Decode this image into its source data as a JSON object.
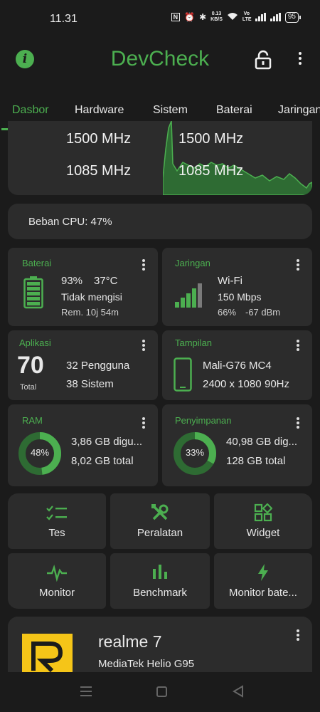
{
  "status_bar": {
    "time": "11.31",
    "nfc": "N",
    "speed_value": "0.13",
    "speed_unit": "KB/S",
    "volte": "Vo LTE",
    "battery": "95"
  },
  "app_bar": {
    "title": "DevCheck",
    "info_icon": "i"
  },
  "tabs": [
    "Dasbor",
    "Hardware",
    "Sistem",
    "Baterai",
    "Jaringan"
  ],
  "cpu_freq": {
    "rows": [
      {
        "left": "1500 MHz",
        "right": "1500 MHz"
      },
      {
        "left": "1085 MHz",
        "right": "1085 MHz"
      }
    ]
  },
  "cpu_load": {
    "label": "Beban CPU: 47%",
    "value_percent": 47
  },
  "battery_card": {
    "title": "Baterai",
    "level": "93%",
    "temp": "37°C",
    "status": "Tidak mengisi",
    "remaining": "Rem. 10j 54m"
  },
  "network_card": {
    "title": "Jaringan",
    "type": "Wi-Fi",
    "speed": "150 Mbps",
    "signal_percent": "66%",
    "signal_dbm": "-67 dBm"
  },
  "apps_card": {
    "title": "Aplikasi",
    "total": "70",
    "total_label": "Total",
    "user": "32 Pengguna",
    "system": "38 Sistem"
  },
  "display_card": {
    "title": "Tampilan",
    "gpu": "Mali-G76 MC4",
    "resolution": "2400 x 1080",
    "refresh": "90Hz"
  },
  "ram_card": {
    "title": "RAM",
    "percent": "48%",
    "percent_value": 48,
    "used": "3,86 GB digu...",
    "total": "8,02 GB total"
  },
  "storage_card": {
    "title": "Penyimpanan",
    "percent": "33%",
    "percent_value": 33,
    "used": "40,98 GB dig...",
    "total": "128 GB total"
  },
  "tools": [
    {
      "label": "Tes",
      "icon": "checklist-icon"
    },
    {
      "label": "Peralatan",
      "icon": "tools-icon"
    },
    {
      "label": "Widget",
      "icon": "widget-icon"
    },
    {
      "label": "Monitor",
      "icon": "pulse-icon"
    },
    {
      "label": "Benchmark",
      "icon": "bar-chart-icon"
    },
    {
      "label": "Monitor bate...",
      "icon": "bolt-icon"
    }
  ],
  "device_card": {
    "name": "realme 7",
    "chip": "MediaTek Helio G95"
  },
  "colors": {
    "accent": "#4caf50",
    "background": "#1b1b1b",
    "card": "#2c2c2c",
    "logo_yellow": "#f5c518"
  }
}
